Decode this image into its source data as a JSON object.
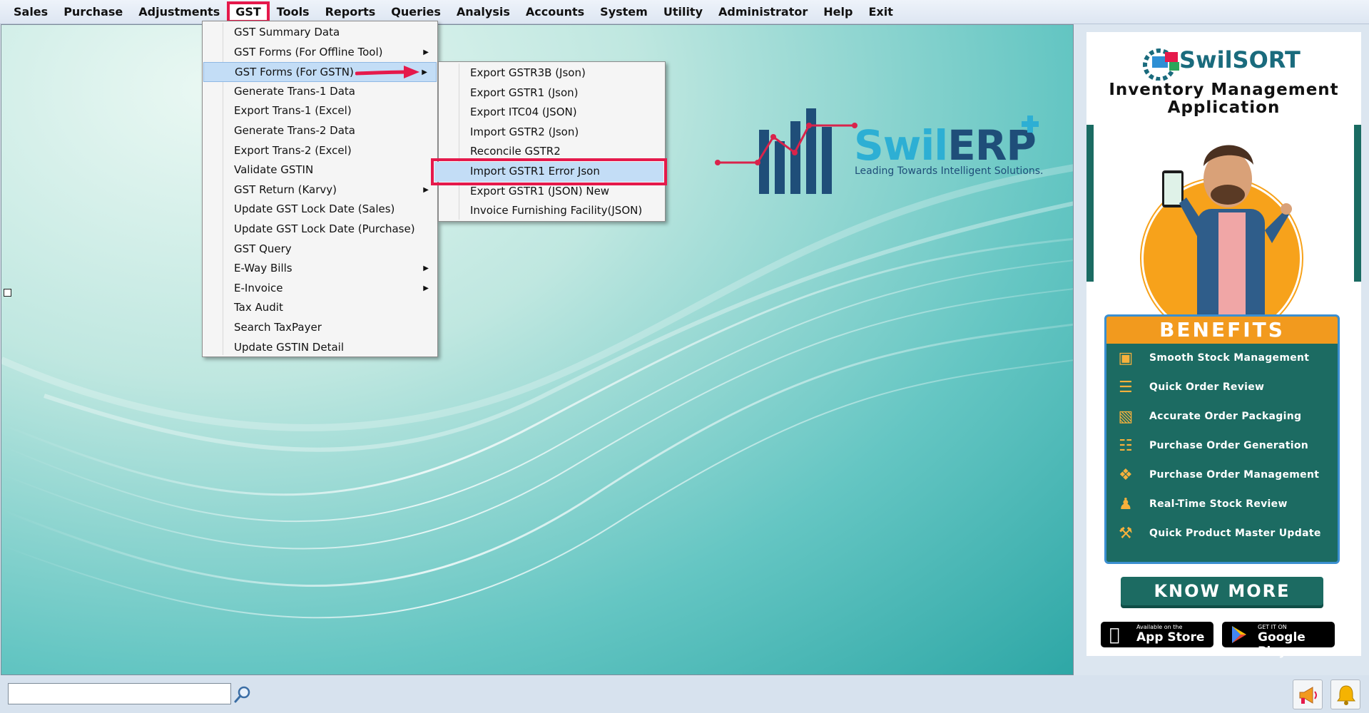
{
  "menubar": {
    "items": [
      "Sales",
      "Purchase",
      "Adjustments",
      "GST",
      "Tools",
      "Reports",
      "Queries",
      "Analysis",
      "Accounts",
      "System",
      "Utility",
      "Administrator",
      "Help",
      "Exit"
    ],
    "active": "GST"
  },
  "gst_menu": {
    "items": [
      {
        "label": "GST Summary Data",
        "submenu": false
      },
      {
        "label": "GST Forms (For Offline Tool)",
        "submenu": true
      },
      {
        "label": "GST Forms (For GSTN)",
        "submenu": true,
        "highlighted": true
      },
      {
        "label": "Generate Trans-1 Data",
        "submenu": false
      },
      {
        "label": "Export Trans-1 (Excel)",
        "submenu": false
      },
      {
        "label": "Generate Trans-2 Data",
        "submenu": false
      },
      {
        "label": "Export Trans-2 (Excel)",
        "submenu": false
      },
      {
        "label": "Validate GSTIN",
        "submenu": false
      },
      {
        "label": "GST Return (Karvy)",
        "submenu": true
      },
      {
        "label": "Update GST Lock Date (Sales)",
        "submenu": false
      },
      {
        "label": "Update GST Lock Date (Purchase)",
        "submenu": false
      },
      {
        "label": "GST Query",
        "submenu": false
      },
      {
        "label": "E-Way Bills",
        "submenu": true
      },
      {
        "label": "E-Invoice",
        "submenu": true
      },
      {
        "label": "Tax Audit",
        "submenu": false
      },
      {
        "label": "Search TaxPayer",
        "submenu": false
      },
      {
        "label": "Update GSTIN Detail",
        "submenu": false
      }
    ]
  },
  "gstn_submenu": {
    "items": [
      {
        "label": "Export GSTR3B (Json)"
      },
      {
        "label": "Export GSTR1 (Json)"
      },
      {
        "label": "Export ITC04 (JSON)"
      },
      {
        "label": "Import GSTR2 (Json)"
      },
      {
        "label": "Reconcile GSTR2"
      },
      {
        "label": "Import GSTR1 Error Json",
        "selected": true
      },
      {
        "label": "Export GSTR1 (JSON) New"
      },
      {
        "label": "Invoice Furnishing Facility(JSON)"
      }
    ]
  },
  "logo": {
    "brand_prefix": "Swil",
    "brand_suffix": "ERP",
    "tagline": "Leading Towards Intelligent Solutions."
  },
  "ad": {
    "brand": "SwilSORT",
    "heading_line1": "Inventory Management",
    "heading_line2": "Application",
    "benefits_title": "BENEFITS",
    "benefits": [
      "Smooth Stock Management",
      "Quick Order Review",
      "Accurate Order Packaging",
      "Purchase Order Generation",
      "Purchase Order Management",
      "Real-Time Stock Review",
      "Quick Product Master Update"
    ],
    "cta": "KNOW MORE",
    "app_store_small": "Available on the",
    "app_store": "App Store",
    "google_small": "GET IT ON",
    "google": "Google Play"
  },
  "bottombar": {
    "search_value": ""
  },
  "colors": {
    "highlight_red": "#e5194b",
    "menu_highlight": "#c3ddf6",
    "ad_green": "#1c6b62",
    "ad_orange": "#f29a1e"
  }
}
